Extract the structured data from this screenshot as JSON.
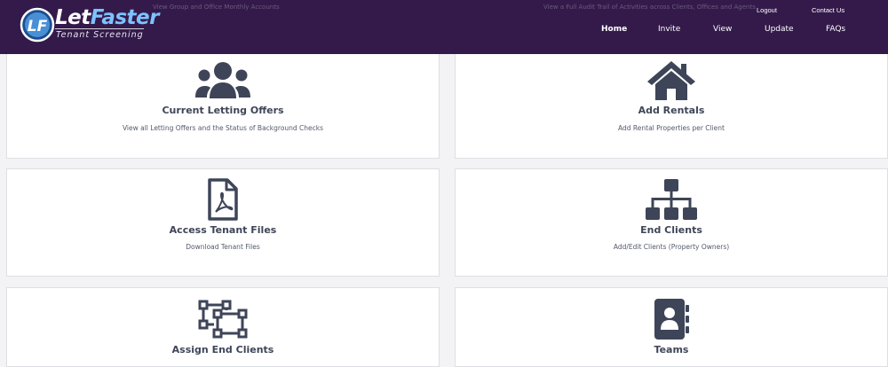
{
  "header": {
    "behind_left": "View Group and Office Monthly Accounts",
    "behind_right": "View a Full Audit Trail of Activities across Clients, Offices and Agents",
    "logo": {
      "word_part1": "Let",
      "word_part2": "Faster",
      "subtitle": "Tenant Screening",
      "badge": "LF"
    },
    "util_links": {
      "logout": "Logout",
      "contact": "Contact Us"
    },
    "nav": {
      "home": "Home",
      "invite": "Invite",
      "view": "View",
      "update": "Update",
      "faqs": "FAQs"
    },
    "colors": {
      "background": "#341a4b",
      "logo_accent": "#7cc3ff"
    }
  },
  "cards": {
    "letting_offers": {
      "icon": "users-icon",
      "title": "Current Letting Offers",
      "description": "View all Letting Offers and the Status of Background Checks"
    },
    "add_rentals": {
      "icon": "house-icon",
      "title": "Add Rentals",
      "description": "Add Rental Properties per Client"
    },
    "tenant_files": {
      "icon": "pdf-file-icon",
      "title": "Access Tenant Files",
      "description": "Download Tenant Files"
    },
    "end_clients": {
      "icon": "sitemap-icon",
      "title": "End Clients",
      "description": "Add/Edit Clients (Property Owners)"
    },
    "assign_clients": {
      "icon": "object-group-icon",
      "title": "Assign End Clients"
    },
    "teams": {
      "icon": "address-book-icon",
      "title": "Teams"
    }
  },
  "colors": {
    "icon": "#3f4558",
    "card_border": "#dedfe4",
    "page_bg": "#f3f3f5"
  }
}
